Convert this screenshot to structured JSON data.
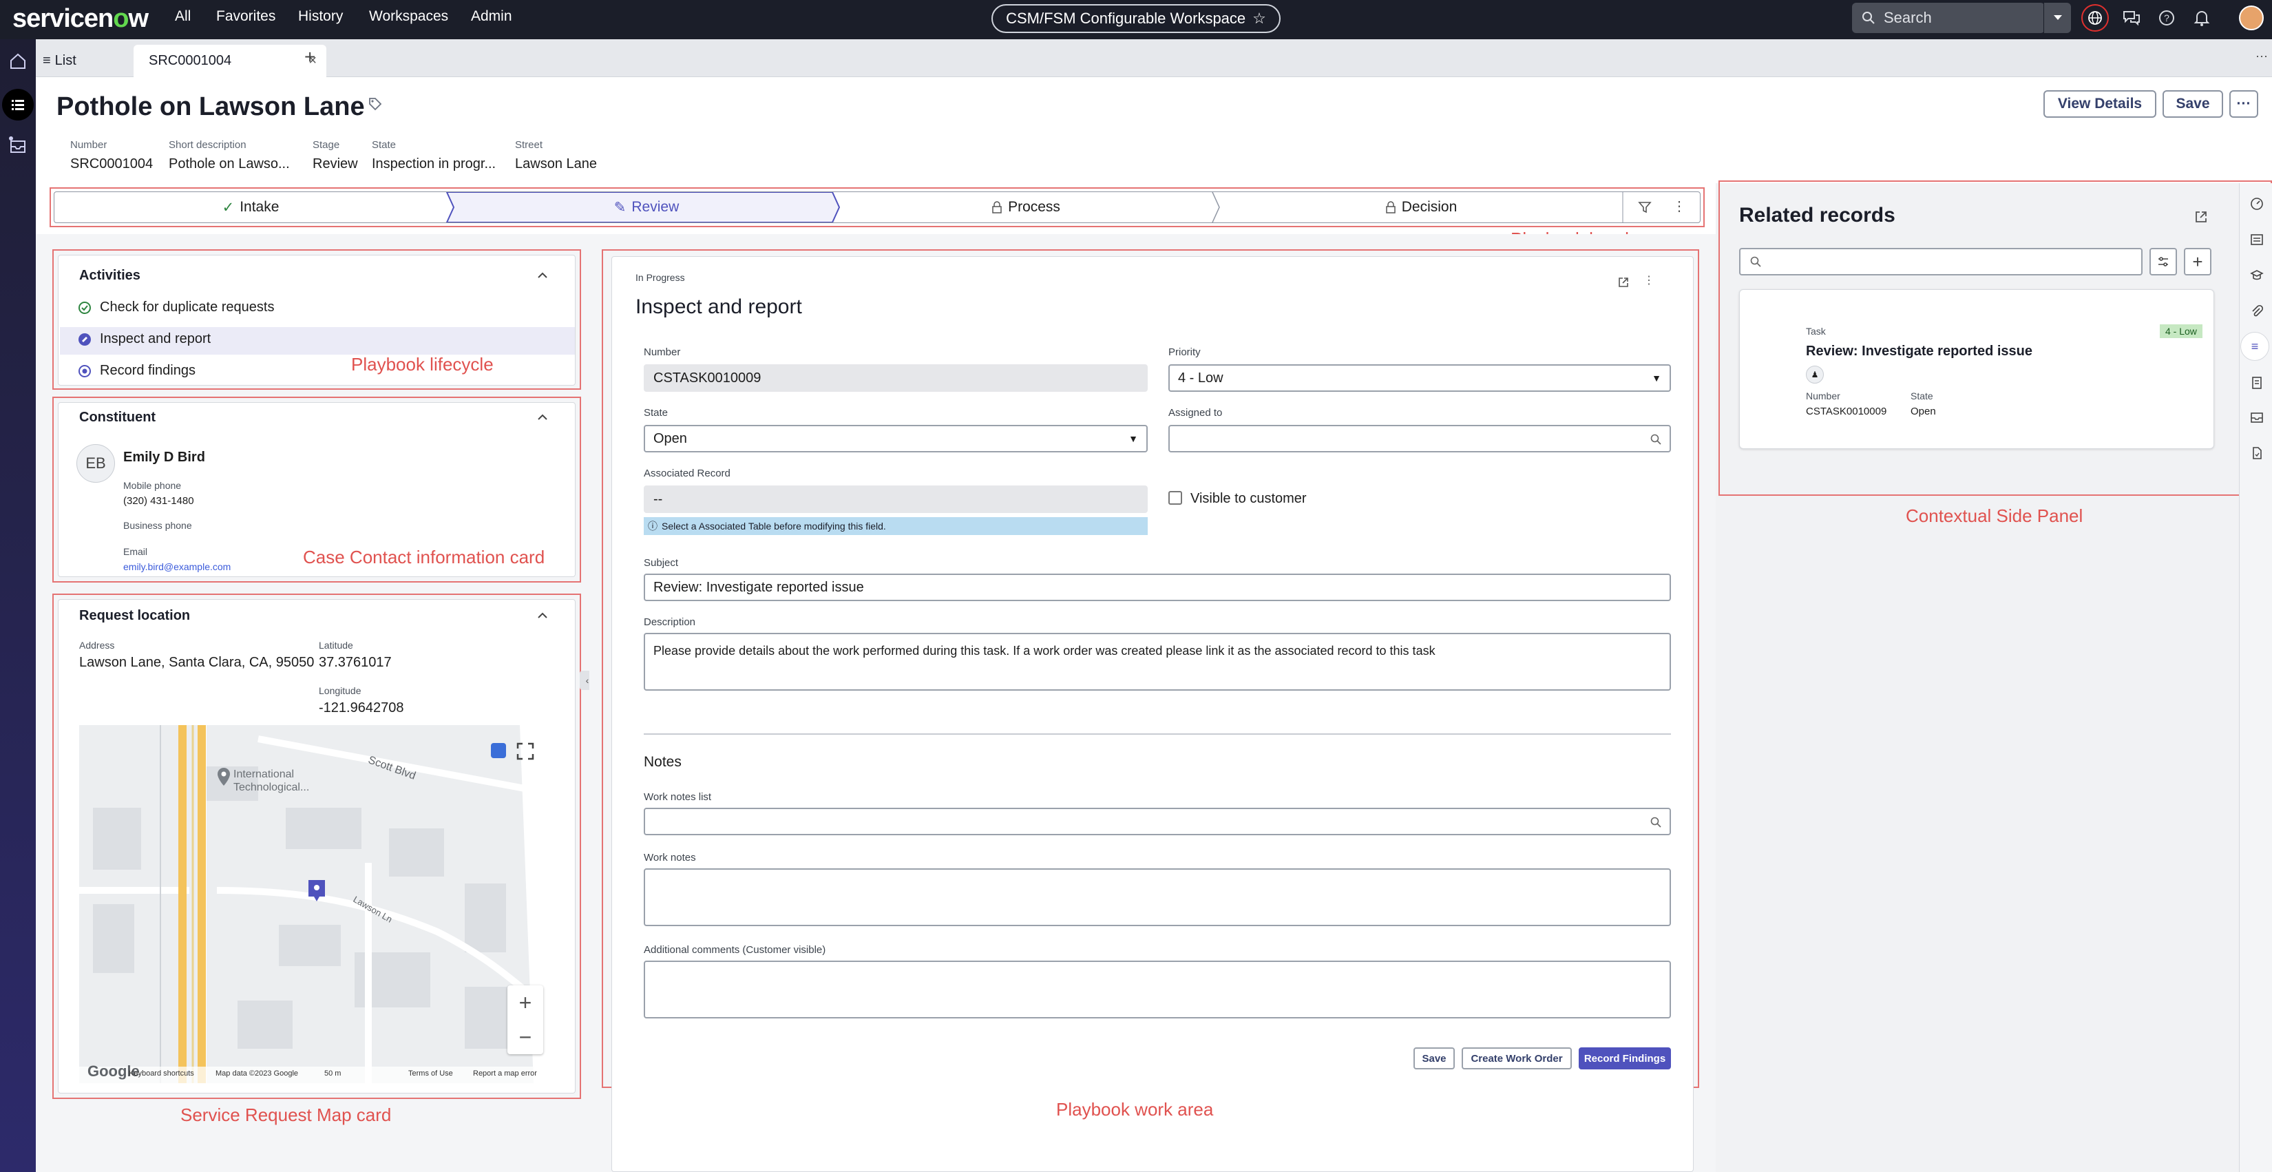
{
  "topbar": {
    "logo_pre": "servicen",
    "logo_o": "o",
    "logo_post": "w",
    "nav": [
      "All",
      "Favorites",
      "History",
      "Workspaces",
      "Admin"
    ],
    "workspace_title": "CSM/FSM Configurable Workspace",
    "search_placeholder": "Search"
  },
  "tabs": {
    "list_label": "List",
    "record_tab": "SRC0001004"
  },
  "record": {
    "title": "Pothole on Lawson Lane",
    "fields": [
      {
        "label": "Number",
        "value": "SRC0001004"
      },
      {
        "label": "Short description",
        "value": "Pothole on Lawso..."
      },
      {
        "label": "Stage",
        "value": "Review"
      },
      {
        "label": "State",
        "value": "Inspection in progr..."
      },
      {
        "label": "Street",
        "value": "Lawson Lane"
      }
    ],
    "view_details": "View Details",
    "save": "Save"
  },
  "playbook": {
    "stages": [
      "Intake",
      "Review",
      "Process",
      "Decision"
    ],
    "active_stage": "Review"
  },
  "annotations": {
    "playbook_header": "Playbook header",
    "playbook_lifecycle": "Playbook lifecycle",
    "contact_card": "Case Contact information card",
    "map_card": "Service Request Map card",
    "work_area": "Playbook work area",
    "side_panel": "Contextual Side Panel"
  },
  "activities": {
    "title": "Activities",
    "items": [
      "Check for duplicate requests",
      "Inspect and report",
      "Record findings"
    ]
  },
  "constituent": {
    "title": "Constituent",
    "initials": "EB",
    "name": "Emily D Bird",
    "mobile_label": "Mobile phone",
    "mobile": "(320) 431-1480",
    "business_label": "Business phone",
    "email_label": "Email",
    "email": "emily.bird@example.com"
  },
  "location": {
    "title": "Request location",
    "address_label": "Address",
    "address": "Lawson Lane, Santa Clara, CA, 95050",
    "latitude_label": "Latitude",
    "latitude": "37.3761017",
    "longitude_label": "Longitude",
    "longitude": "-121.9642708",
    "map_place": "International Technological...",
    "map_street1": "Scott Blvd",
    "map_street2": "Lawson Ln",
    "map_footer": [
      "Keyboard shortcuts",
      "Map data ©2023 Google",
      "50 m",
      "Terms of Use",
      "Report a map error"
    ],
    "google": "Google"
  },
  "task": {
    "status": "In Progress",
    "title": "Inspect and report",
    "number_label": "Number",
    "number": "CSTASK0010009",
    "priority_label": "Priority",
    "priority": "4 - Low",
    "state_label": "State",
    "state": "Open",
    "assigned_label": "Assigned to",
    "assoc_label": "Associated Record",
    "assoc_value": "--",
    "assoc_hint": "Select a Associated Table before modifying this field.",
    "visible_label": "Visible to customer",
    "subject_label": "Subject",
    "subject": "Review: Investigate reported issue",
    "description_label": "Description",
    "description": "Please provide details about the work performed during this task.  If a work order was created please link it as the associated record to this task",
    "notes_heading": "Notes",
    "work_notes_list_label": "Work notes list",
    "work_notes_label": "Work notes",
    "comments_label": "Additional comments (Customer visible)",
    "btn_save": "Save",
    "btn_create": "Create Work Order",
    "btn_record": "Record Findings"
  },
  "related": {
    "title": "Related records",
    "card_type": "Task",
    "card_badge": "4 - Low",
    "card_title": "Review: Investigate reported issue",
    "number_label": "Number",
    "number": "CSTASK0010009",
    "state_label": "State",
    "state": "Open"
  },
  "colors": {
    "accent": "#4f52bd",
    "annotation": "#e0524f",
    "topbar": "#1b1e29",
    "success": "#2e8540",
    "badge_low": "#c6e8c2"
  }
}
